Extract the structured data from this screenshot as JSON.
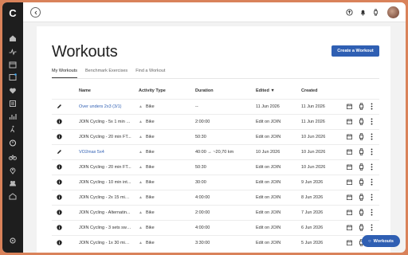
{
  "app": {
    "logo_letter": "C"
  },
  "colors": {
    "accent": "#2f5fb3",
    "sidebar": "#1e1e1e",
    "frame": "#d9825a"
  },
  "sidebar": {
    "icons": [
      "home-icon",
      "activity-icon",
      "calendar-icon",
      "plan-icon",
      "health-icon",
      "library-icon",
      "stats-icon",
      "run-icon",
      "workouts-icon",
      "bike-icon",
      "location-icon",
      "community-icon",
      "groups-icon",
      "settings-icon"
    ]
  },
  "topbar": {
    "icons": [
      "back-icon",
      "upload-icon",
      "notification-icon",
      "watch-icon",
      "avatar"
    ]
  },
  "page": {
    "title": "Workouts",
    "create_button": "Create a Workout",
    "tabs": [
      {
        "label": "My Workouts",
        "active": true
      },
      {
        "label": "Benchmark Exercises",
        "active": false
      },
      {
        "label": "Find a Workout",
        "active": false
      }
    ]
  },
  "table": {
    "headers": {
      "name": "Name",
      "activity_type": "Activity Type",
      "duration": "Duration",
      "edited": "Edited ▼",
      "created": "Created"
    },
    "rows": [
      {
        "icon": "pencil-icon",
        "name": "Over unders 2x3 (3/1)",
        "link": true,
        "type": "Bike",
        "duration": "--",
        "edited": "11 Jun 2026",
        "created": "11 Jun 2026"
      },
      {
        "icon": "info-icon",
        "name": "JOIN Cycling - 5x 1 min s...",
        "link": false,
        "type": "Bike",
        "duration": "2:00:00",
        "edited": "Edit on JOIN",
        "created": "11 Jun 2026"
      },
      {
        "icon": "info-icon",
        "name": "JOIN Cycling - 20 min FT...",
        "link": false,
        "type": "Bike",
        "duration": "50:30",
        "edited": "Edit on JOIN",
        "created": "10 Jun 2026"
      },
      {
        "icon": "pencil-icon",
        "name": "VO2max 5x4",
        "link": true,
        "type": "Bike",
        "duration": "40:00 → ~20,70 km",
        "edited": "10 Jun 2026",
        "created": "10 Jun 2026"
      },
      {
        "icon": "info-icon",
        "name": "JOIN Cycling - 20 min FT...",
        "link": false,
        "type": "Bike",
        "duration": "50:30",
        "edited": "Edit on JOIN",
        "created": "10 Jun 2026"
      },
      {
        "icon": "info-icon",
        "name": "JOIN Cycling - 10 min int...",
        "link": false,
        "type": "Bike",
        "duration": "30:00",
        "edited": "Edit on JOIN",
        "created": "9 Jun 2026"
      },
      {
        "icon": "info-icon",
        "name": "JOIN Cycling - 2x 15 min ...",
        "link": false,
        "type": "Bike",
        "duration": "4:00:00",
        "edited": "Edit on JOIN",
        "created": "8 Jun 2026"
      },
      {
        "icon": "info-icon",
        "name": "JOIN Cycling - Alternatin...",
        "link": false,
        "type": "Bike",
        "duration": "2:00:00",
        "edited": "Edit on JOIN",
        "created": "7 Jun 2026"
      },
      {
        "icon": "info-icon",
        "name": "JOIN Cycling - 3 sets swe...",
        "link": false,
        "type": "Bike",
        "duration": "4:00:00",
        "edited": "Edit on JOIN",
        "created": "6 Jun 2026"
      },
      {
        "icon": "info-icon",
        "name": "JOIN Cycling - 1x 30 min ...",
        "link": false,
        "type": "Bike",
        "duration": "3:30:00",
        "edited": "Edit on JOIN",
        "created": "5 Jun 2026"
      }
    ]
  },
  "fab": {
    "label": "Workouts",
    "icon": "chat-icon"
  }
}
